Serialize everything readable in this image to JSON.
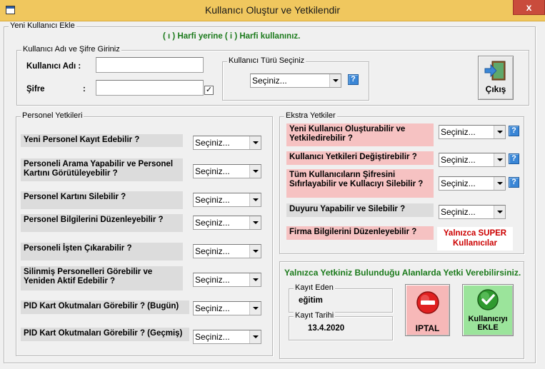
{
  "window": {
    "title": "Kullanıcı Oluştur ve Yetkilendir",
    "close_glyph": "x"
  },
  "main_group": {
    "label": "Yeni Kullanıcı Ekle",
    "notice": "( ı ) Harfi yerine ( i ) Harfi kullanınız."
  },
  "credentials": {
    "group_label": "Kullanıcı Adı ve Şifre Giriniz",
    "username_label": "Kullanıcı Adı :",
    "username_value": "",
    "password_label": "Şifre",
    "password_colon": ":",
    "password_value": "",
    "show_password_checked": true,
    "check_glyph": "✓"
  },
  "user_type": {
    "group_label": "Kullanıcı Türü Seçiniz",
    "selected": "Seçiniz...",
    "help_glyph": "?"
  },
  "exit_button": {
    "label": "Çıkış"
  },
  "personnel": {
    "group_label": "Personel Yetkileri",
    "items": [
      {
        "label": "Yeni Personel Kayıt Edebilir ?",
        "selected": "Seçiniz..."
      },
      {
        "label": "Personeli Arama Yapabilir ve Personel Kartını Görütüleyebilir ?",
        "selected": "Seçiniz..."
      },
      {
        "label": "Personel Kartını Silebilir ?",
        "selected": "Seçiniz..."
      },
      {
        "label": "Personel Bilgilerini Düzenleyebilir ?",
        "selected": "Seçiniz..."
      },
      {
        "label": "Personeli İşten Çıkarabilir ?",
        "selected": "Seçiniz..."
      },
      {
        "label": "Silinmiş Personelleri Görebilir ve Yeniden Aktif Edebilir ?",
        "selected": "Seçiniz..."
      },
      {
        "label": "PID Kart Okutmaları Görebilir ? (Bugün)",
        "selected": "Seçiniz..."
      },
      {
        "label": "PID Kart Okutmaları Görebilir ? (Geçmiş)",
        "selected": "Seçiniz..."
      }
    ]
  },
  "extra": {
    "group_label": "Ekstra Yetkiler",
    "items": [
      {
        "label": "Yeni Kullanıcı Oluşturabilir ve Yetkiledirebilir ?",
        "selected": "Seçiniz...",
        "help": "?"
      },
      {
        "label": "Kullanıcı Yetkileri Değiştirebilir ?",
        "selected": "Seçiniz...",
        "help": "?"
      },
      {
        "label": "Tüm Kullanıcıların Şifresini Sıfırlayabilir ve Kullacıyı Silebilir ?",
        "selected": "Seçiniz...",
        "help": "?"
      },
      {
        "label": "Duyuru Yapabilir ve Silebilir ?",
        "selected": "Seçiniz..."
      },
      {
        "label": "Firma Bilgilerini Düzenleyebilir ?",
        "note": "Yalnızca SUPER Kullanıcılar"
      }
    ]
  },
  "record": {
    "notice": "Yalnızca Yetkiniz Bulunduğu Alanlarda Yetki Verebilirsiniz.",
    "created_by_label": "Kayıt Eden",
    "created_by_value": "eğitim",
    "date_label": "Kayıt Tarihi",
    "date_value": "13.4.2020"
  },
  "actions": {
    "cancel_label": "IPTAL",
    "add_label": "Kullanıcıyı EKLE"
  },
  "colors": {
    "titlebar": "#f0c75e",
    "notice_green": "#1b7a1b",
    "pink_label": "#f6c2c2",
    "super_red": "#cc0000",
    "cancel_bg": "#f7b8b8",
    "add_bg": "#9be49b"
  }
}
